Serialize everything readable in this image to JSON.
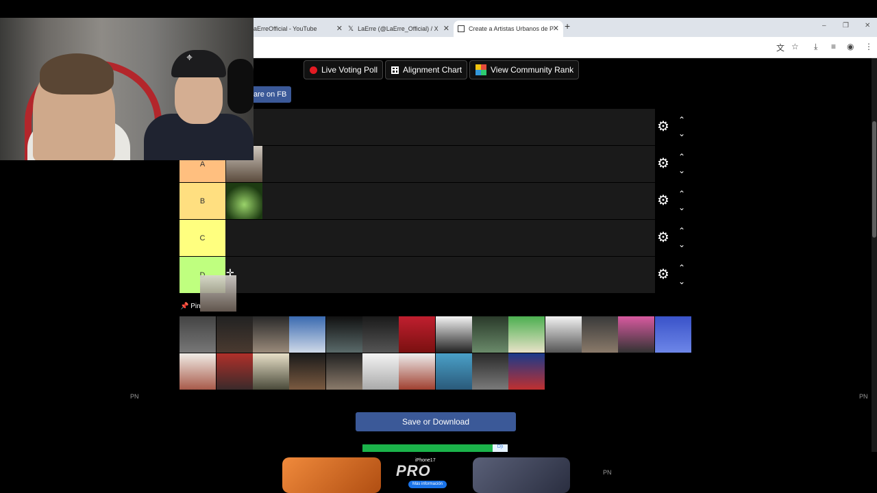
{
  "browser": {
    "tabs": [
      {
        "title": "aErreOfficial - YouTube",
        "icon": "youtube-icon"
      },
      {
        "title": "LaErre (@LaErre_Official) / X",
        "icon": "x-logo-icon"
      },
      {
        "title": "Create a Artistas Urbanos de P",
        "icon": "tiermaker-icon",
        "active": true
      }
    ],
    "new_tab": "+",
    "window_controls": [
      "–",
      "❐",
      "✕"
    ]
  },
  "toolbar": {
    "live_voting_poll": "Live Voting Poll",
    "alignment_chart": "Alignment Chart",
    "view_community_rank": "View Community Rank",
    "share_fb": "are on FB"
  },
  "tiers": [
    {
      "label": "",
      "color": "#ffffff"
    },
    {
      "label": "A",
      "color": "#ffbf7f"
    },
    {
      "label": "B",
      "color": "#ffdf80"
    },
    {
      "label": "C",
      "color": "#ffff7f"
    },
    {
      "label": "D",
      "color": "#bfff7f"
    }
  ],
  "tier_controls": {
    "gear": "⚙",
    "up": "⌃",
    "down": "⌄"
  },
  "pin_label": "Pin",
  "side_labels": {
    "left": "PN",
    "right": "PN",
    "ad": "PN"
  },
  "save_button": "Save or Download",
  "ad": {
    "brand_line": "iPhone17",
    "headline": "PRO",
    "more": "Más información",
    "badge": "D|i"
  }
}
